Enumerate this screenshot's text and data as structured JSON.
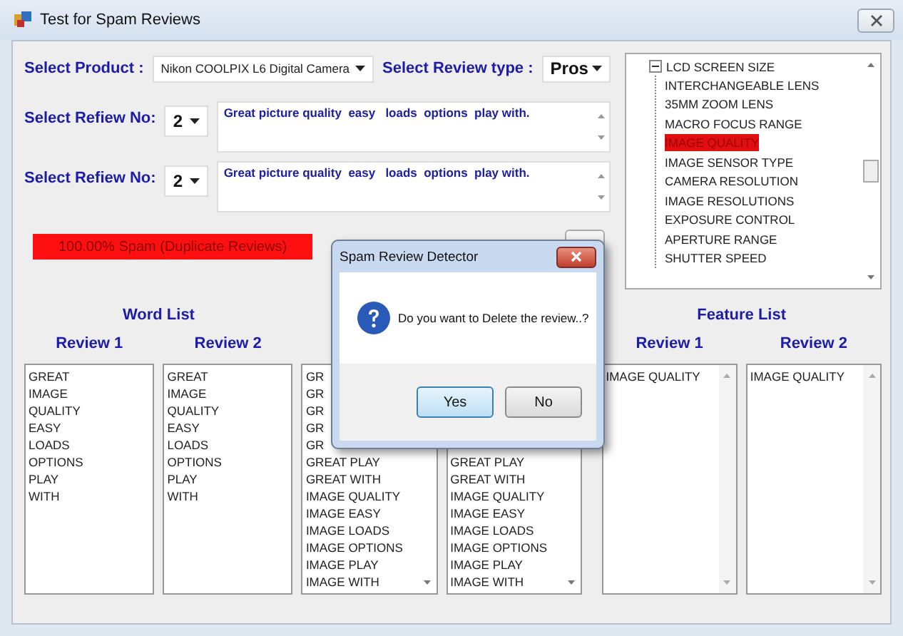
{
  "window": {
    "title": "Test for Spam Reviews"
  },
  "product": {
    "label": "Select Product :",
    "value": "Nikon COOLPIX L6 Digital Camera"
  },
  "review_type": {
    "label": "Select Review type :",
    "value": "Pros"
  },
  "reviews": [
    {
      "label": "Select Refiew No:",
      "number": "2",
      "text": "Great picture quality  easy   loads  options  play with."
    },
    {
      "label": "Select Refiew No:",
      "number": "2",
      "text": "Great picture quality  easy   loads  options  play with."
    }
  ],
  "spam_result": "100.00% Spam (Duplicate Reviews)",
  "feature_tree": [
    {
      "label": "LCD SCREEN SIZE",
      "expanded": true,
      "selected": false,
      "children": [
        {
          "label": "INTERCHANGEABLE LENS",
          "selected": false
        },
        {
          "label": "35MM ZOOM LENS",
          "selected": false
        },
        {
          "label": "MACRO FOCUS RANGE",
          "selected": false
        },
        {
          "label": "IMAGE QUALITY",
          "selected": true
        },
        {
          "label": "IMAGE SENSOR TYPE",
          "selected": false
        },
        {
          "label": "CAMERA RESOLUTION",
          "selected": false
        },
        {
          "label": "IMAGE RESOLUTIONS",
          "selected": false
        },
        {
          "label": "EXPOSURE CONTROL",
          "selected": false
        },
        {
          "label": "APERTURE RANGE",
          "selected": false
        },
        {
          "label": "SHUTTER SPEED",
          "selected": false
        }
      ]
    }
  ],
  "word_list": {
    "title": "Word List",
    "columns": [
      {
        "heading": "Review 1",
        "items": [
          "GREAT",
          "IMAGE",
          "QUALITY",
          "EASY",
          "LOADS",
          "OPTIONS",
          "PLAY",
          "WITH"
        ]
      },
      {
        "heading": "Review 2",
        "items": [
          "GREAT",
          "IMAGE",
          "QUALITY",
          "EASY",
          "LOADS",
          "OPTIONS",
          "PLAY",
          "WITH"
        ]
      }
    ]
  },
  "phrase_lists": {
    "columns": [
      {
        "items": [
          "GR",
          "GR",
          "GR",
          "GR",
          "GR",
          "GREAT PLAY",
          "GREAT WITH",
          "IMAGE QUALITY",
          "IMAGE EASY",
          "IMAGE LOADS",
          "IMAGE OPTIONS",
          "IMAGE PLAY",
          "IMAGE WITH"
        ]
      },
      {
        "items": [
          "GREAT PLAY",
          "GREAT WITH",
          "IMAGE QUALITY",
          "IMAGE EASY",
          "IMAGE LOADS",
          "IMAGE OPTIONS",
          "IMAGE PLAY",
          "IMAGE WITH"
        ]
      }
    ]
  },
  "feature_list": {
    "title": "Feature List",
    "columns": [
      {
        "heading": "Review 1",
        "items": [
          "IMAGE QUALITY"
        ]
      },
      {
        "heading": "Review 2",
        "items": [
          "IMAGE QUALITY"
        ]
      }
    ]
  },
  "dialog": {
    "title": "Spam Review Detector",
    "message": "Do you want to Delete the review..?",
    "buttons": [
      {
        "label": "Yes",
        "selected": true
      },
      {
        "label": "No",
        "selected": false
      }
    ]
  }
}
